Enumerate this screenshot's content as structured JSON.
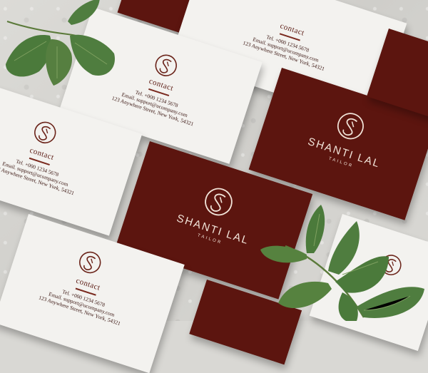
{
  "brand": {
    "name": "SHANTI LAL",
    "subtitle": "TAILOR"
  },
  "contact": {
    "heading": "contact",
    "tel": "Tel. +000 1234 5678",
    "email": "Email. support@ucompany.com",
    "address": "123 Anywhere Street, New York, 54321"
  },
  "colors": {
    "card_red": "#5c150f",
    "card_white": "#f3f2ef",
    "leaf": "#4f7d3f",
    "stone": "#d9d8d4"
  },
  "icons": [
    "s-monogram-logo",
    "leaf-branch"
  ]
}
